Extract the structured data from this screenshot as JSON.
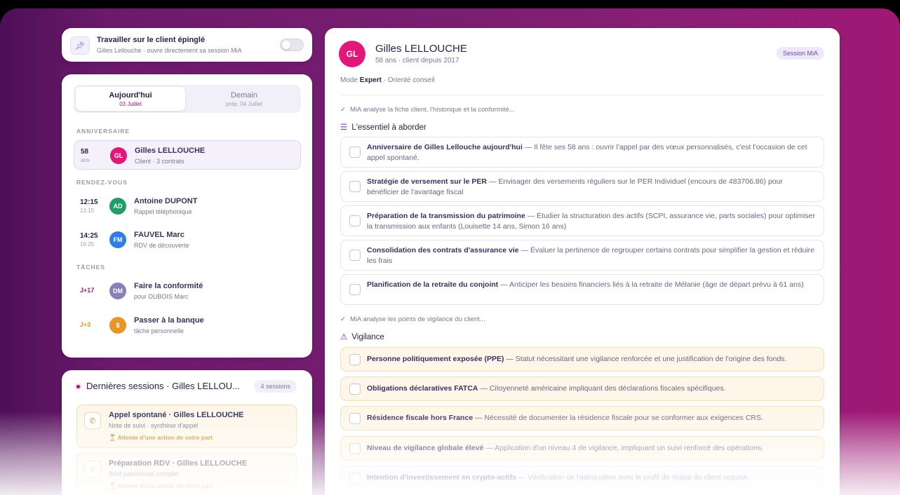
{
  "pin": {
    "title": "Travailler sur le client épinglé",
    "subtitle": "Gilles Lellouche · ouvre directement sa session MiA",
    "icon": "pin-icon"
  },
  "agenda": {
    "tabs": [
      {
        "label": "Aujourd'hui",
        "sub": "03 Juillet"
      },
      {
        "label": "Demain",
        "sub": "prép. 04 Juillet"
      }
    ],
    "sections": {
      "birthday": "ANNIVERSAIRE",
      "meetings": "RENDEZ-VOUS",
      "tasks": "TÂCHES"
    },
    "birthday": {
      "age": "58",
      "age_unit": "ans",
      "initials": "GL",
      "name": "Gilles LELLOUCHE",
      "sub": "Client · 3 contrats"
    },
    "meetings": [
      {
        "time": "12:15",
        "end": "13:15",
        "initials": "AD",
        "name": "Antoine DUPONT",
        "sub": "Rappel téléphonique",
        "color": "#1f9e6a"
      },
      {
        "time": "14:25",
        "end": "16:25",
        "initials": "FM",
        "name": "FAUVEL Marc",
        "sub": "RDV de découverte",
        "color": "#2f7fe0"
      }
    ],
    "tasks": [
      {
        "tag": "J+17",
        "initials": "DM",
        "name": "Faire la conformité",
        "sub": "pour DUBOIS Marc",
        "color": "#8a7fb8",
        "tag_color": "#a01874"
      },
      {
        "tag": "J+3",
        "initials": "$",
        "name": "Passer à la banque",
        "sub": "tâche personnelle",
        "color": "#e8952a",
        "tag_color": "#e8952a"
      }
    ]
  },
  "sessions": {
    "title": "Dernières sessions · Gilles LELLOU...",
    "count": "4 sessions",
    "items": [
      {
        "name": "Appel spontané · Gilles LELLOUCHE",
        "sub": "Note de suivi · synthèse d'appel",
        "status": "⏳ Attente d'une action de votre part",
        "icon": "phone-icon"
      },
      {
        "name": "Préparation RDV · Gilles LELLOUCHE",
        "sub": "Brief patrimonial complet",
        "status": "⏳ Attente d'une action de votre part",
        "icon": "user-icon"
      }
    ]
  },
  "client": {
    "initials": "GL",
    "name": "Gilles LELLOUCHE",
    "meta": "58 ans · client depuis 2017",
    "badge": "Session MiA",
    "mode_prefix": "Mode",
    "mode_value": "Expert",
    "mode_suffix": "· Orienté conseil"
  },
  "analysis": {
    "status1": "MiA analyse la fiche client, l'historique et la conformité...",
    "essentials_title": "L'essentiel à aborder",
    "essentials": [
      {
        "title": "Anniversaire de Gilles Lellouche aujourd'hui",
        "text": " — Il fête ses 58 ans : ouvrir l'appel par des vœux personnalisés, c'est l'occasion de cet appel spontané."
      },
      {
        "title": "Stratégie de versement sur le PER",
        "text": " — Envisager des versements réguliers sur le PER Individuel (encours de 483706.86) pour bénéficier de l'avantage fiscal"
      },
      {
        "title": "Préparation de la transmission du patrimoine",
        "text": " — Étudier la structuration des actifs (SCPI, assurance vie, parts sociales) pour optimiser la transmission aux enfants (Louisette 14 ans, Simon 16 ans)"
      },
      {
        "title": "Consolidation des contrats d'assurance vie",
        "text": " — Évaluer la pertinence de regrouper certains contrats pour simplifier la gestion et réduire les frais"
      },
      {
        "title": "Planification de la retraite du conjoint",
        "text": " — Anticiper les besoins financiers liés à la retraite de Mélanie (âge de départ prévu à 61 ans)"
      }
    ],
    "status2": "MiA analyse les points de vigilance du client...",
    "vigilance_title": "Vigilance",
    "vigilance": [
      {
        "title": "Personne politiquement exposée (PPE)",
        "text": " — Statut nécessitant une vigilance renforcée et une justification de l'origine des fonds."
      },
      {
        "title": "Obligations déclaratives FATCA",
        "text": " — Citoyenneté américaine impliquant des déclarations fiscales spécifiques."
      },
      {
        "title": "Résidence fiscale hors France",
        "text": " — Nécessité de documenter la résidence fiscale pour se conformer aux exigences CRS."
      },
      {
        "title": "Niveau de vigilance globale élevé",
        "text": " — Application d'un niveau 4 de vigilance, impliquant un suivi renforcé des opérations."
      },
      {
        "title": "Intention d'investissement en crypto-actifs",
        "text": " — Vérification de l'adéquation avec le profil de risque du client requise."
      }
    ]
  }
}
